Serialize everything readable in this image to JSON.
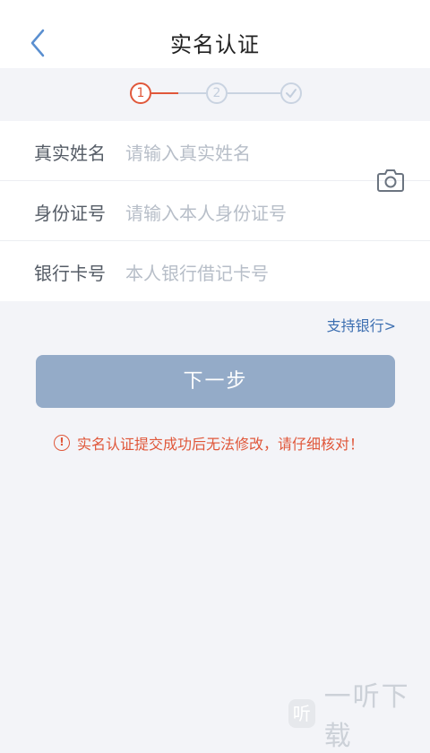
{
  "header": {
    "title": "实名认证"
  },
  "steps": {
    "step1": "1",
    "step2": "2"
  },
  "form": {
    "name": {
      "label": "真实姓名",
      "placeholder": "请输入真实姓名"
    },
    "id": {
      "label": "身份证号",
      "placeholder": "请输入本人身份证号"
    },
    "bank": {
      "label": "银行卡号",
      "placeholder": "本人银行借记卡号"
    }
  },
  "links": {
    "support_banks": "支持银行>"
  },
  "buttons": {
    "next": "下一步"
  },
  "warning": {
    "icon": "!",
    "text": "实名认证提交成功后无法修改，请仔细核对！"
  },
  "watermark": {
    "logo": "听",
    "text": "一听下载"
  },
  "colors": {
    "accent": "#e0573a",
    "button": "#94abc8",
    "link": "#3d6fb1"
  }
}
